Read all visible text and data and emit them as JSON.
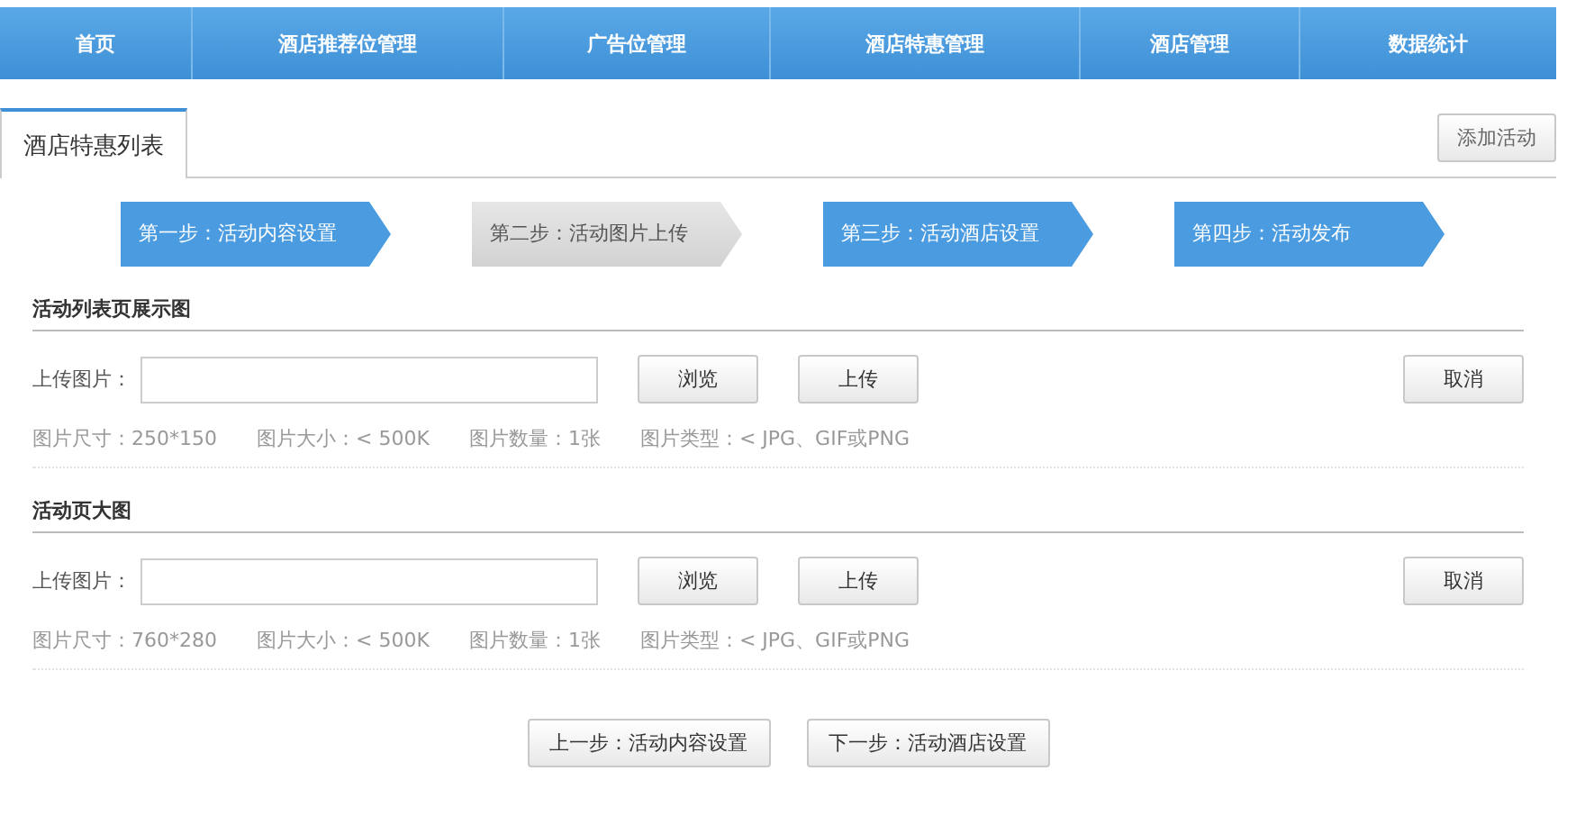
{
  "nav": [
    {
      "label": "首页"
    },
    {
      "label": "酒店推荐位管理"
    },
    {
      "label": "广告位管理"
    },
    {
      "label": "酒店特惠管理"
    },
    {
      "label": "酒店管理"
    },
    {
      "label": "数据统计"
    }
  ],
  "tab": {
    "label": "酒店特惠列表",
    "selected": true
  },
  "add_button": "添加活动",
  "steps": [
    {
      "label": "第一步：活动内容设置",
      "current": false
    },
    {
      "label": "第二步：活动图片上传",
      "current": true
    },
    {
      "label": "第三步：活动酒店设置",
      "current": false
    },
    {
      "label": "第四步：活动发布",
      "current": false
    }
  ],
  "sections": [
    {
      "title": "活动列表页展示图",
      "field_label": "上传图片：",
      "browse": "浏览",
      "upload": "上传",
      "cancel": "取消",
      "specs": [
        "图片尺寸：250*150",
        "图片大小：< 500K",
        "图片数量：1张",
        "图片类型：< JPG、GIF或PNG"
      ]
    },
    {
      "title": "活动页大图",
      "field_label": "上传图片：",
      "browse": "浏览",
      "upload": "上传",
      "cancel": "取消",
      "specs": [
        "图片尺寸：760*280",
        "图片大小：< 500K",
        "图片数量：1张",
        "图片类型：< JPG、GIF或PNG"
      ]
    }
  ],
  "footer_buttons": [
    "上一步：活动内容设置",
    "下一步：活动酒店设置"
  ]
}
